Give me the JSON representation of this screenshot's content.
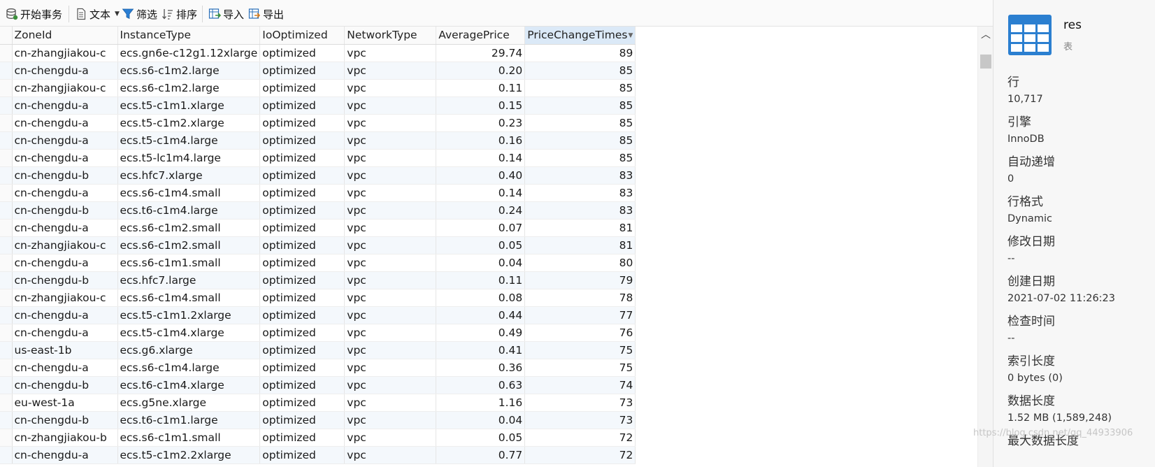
{
  "toolbar": {
    "begin_transaction": "开始事务",
    "text": "文本",
    "filter": "筛选",
    "sort": "排序",
    "import": "导入",
    "export": "导出"
  },
  "columns": [
    "ZoneId",
    "InstanceType",
    "IoOptimized",
    "NetworkType",
    "AveragePrice",
    "PriceChangeTimes"
  ],
  "rows": [
    [
      "cn-zhangjiakou-c",
      "ecs.gn6e-c12g1.12xlarge",
      "optimized",
      "vpc",
      "29.74",
      "89"
    ],
    [
      "cn-chengdu-a",
      "ecs.s6-c1m2.large",
      "optimized",
      "vpc",
      "0.20",
      "85"
    ],
    [
      "cn-zhangjiakou-c",
      "ecs.s6-c1m2.large",
      "optimized",
      "vpc",
      "0.11",
      "85"
    ],
    [
      "cn-chengdu-a",
      "ecs.t5-c1m1.xlarge",
      "optimized",
      "vpc",
      "0.15",
      "85"
    ],
    [
      "cn-chengdu-a",
      "ecs.t5-c1m2.xlarge",
      "optimized",
      "vpc",
      "0.23",
      "85"
    ],
    [
      "cn-chengdu-a",
      "ecs.t5-c1m4.large",
      "optimized",
      "vpc",
      "0.16",
      "85"
    ],
    [
      "cn-chengdu-a",
      "ecs.t5-lc1m4.large",
      "optimized",
      "vpc",
      "0.14",
      "85"
    ],
    [
      "cn-chengdu-b",
      "ecs.hfc7.xlarge",
      "optimized",
      "vpc",
      "0.40",
      "83"
    ],
    [
      "cn-chengdu-a",
      "ecs.s6-c1m4.small",
      "optimized",
      "vpc",
      "0.14",
      "83"
    ],
    [
      "cn-chengdu-b",
      "ecs.t6-c1m4.large",
      "optimized",
      "vpc",
      "0.24",
      "83"
    ],
    [
      "cn-chengdu-a",
      "ecs.s6-c1m2.small",
      "optimized",
      "vpc",
      "0.07",
      "81"
    ],
    [
      "cn-zhangjiakou-c",
      "ecs.s6-c1m2.small",
      "optimized",
      "vpc",
      "0.05",
      "81"
    ],
    [
      "cn-chengdu-a",
      "ecs.s6-c1m1.small",
      "optimized",
      "vpc",
      "0.04",
      "80"
    ],
    [
      "cn-chengdu-b",
      "ecs.hfc7.large",
      "optimized",
      "vpc",
      "0.11",
      "79"
    ],
    [
      "cn-zhangjiakou-c",
      "ecs.s6-c1m4.small",
      "optimized",
      "vpc",
      "0.08",
      "78"
    ],
    [
      "cn-chengdu-a",
      "ecs.t5-c1m1.2xlarge",
      "optimized",
      "vpc",
      "0.44",
      "77"
    ],
    [
      "cn-chengdu-a",
      "ecs.t5-c1m4.xlarge",
      "optimized",
      "vpc",
      "0.49",
      "76"
    ],
    [
      "us-east-1b",
      "ecs.g6.xlarge",
      "optimized",
      "vpc",
      "0.41",
      "75"
    ],
    [
      "cn-chengdu-a",
      "ecs.s6-c1m4.large",
      "optimized",
      "vpc",
      "0.36",
      "75"
    ],
    [
      "cn-chengdu-b",
      "ecs.t6-c1m4.xlarge",
      "optimized",
      "vpc",
      "0.63",
      "74"
    ],
    [
      "eu-west-1a",
      "ecs.g5ne.xlarge",
      "optimized",
      "vpc",
      "1.16",
      "73"
    ],
    [
      "cn-chengdu-b",
      "ecs.t6-c1m1.large",
      "optimized",
      "vpc",
      "0.04",
      "73"
    ],
    [
      "cn-zhangjiakou-b",
      "ecs.s6-c1m1.small",
      "optimized",
      "vpc",
      "0.05",
      "72"
    ],
    [
      "cn-chengdu-a",
      "ecs.t5-c1m2.2xlarge",
      "optimized",
      "vpc",
      "0.77",
      "72"
    ]
  ],
  "info": {
    "name": "res",
    "kind": "表",
    "props": [
      {
        "label": "行",
        "value": "10,717"
      },
      {
        "label": "引擎",
        "value": "InnoDB"
      },
      {
        "label": "自动递增",
        "value": "0"
      },
      {
        "label": "行格式",
        "value": "Dynamic"
      },
      {
        "label": "修改日期",
        "value": "--"
      },
      {
        "label": "创建日期",
        "value": "2021-07-02 11:26:23"
      },
      {
        "label": "检查时间",
        "value": "--"
      },
      {
        "label": "索引长度",
        "value": "0 bytes (0)"
      },
      {
        "label": "数据长度",
        "value": "1.52 MB (1,589,248)"
      },
      {
        "label": "最大数据长度",
        "value": ""
      }
    ]
  },
  "watermark": "https://blog.csdn.net/qq_44933906",
  "colors": {
    "accent": "#1f6fbf",
    "sorted_header": "#dbe9f7",
    "alt_row": "#f4f8fc"
  }
}
